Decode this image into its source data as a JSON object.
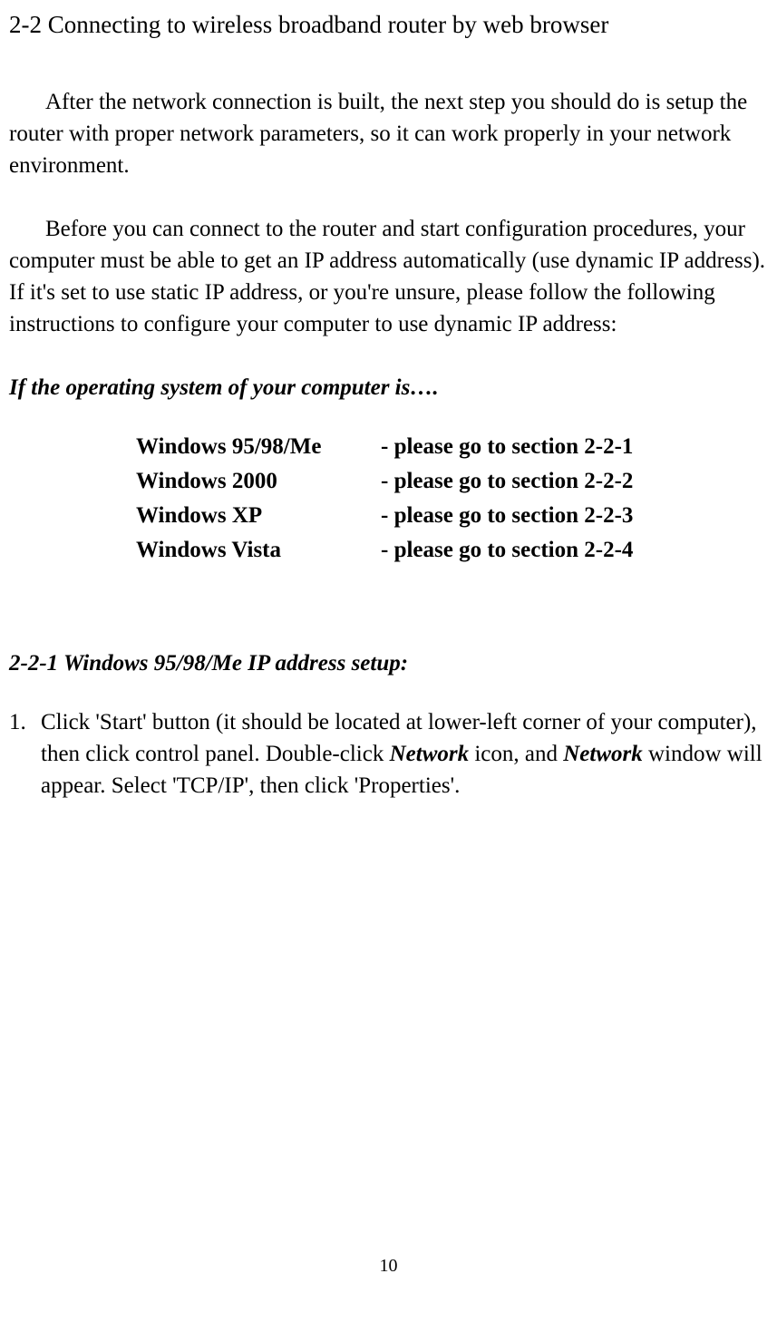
{
  "heading": "2-2 Connecting to wireless broadband router by web browser",
  "para1": "After the network connection is built, the next step you should do is setup the router with proper network parameters, so it can work properly in your network environment.",
  "para2": "Before you can connect to the router and start configuration procedures, your computer must be able to get an IP address automatically (use dynamic IP address). If it's set to use static IP address, or you're unsure, please follow the following instructions to configure your computer to use dynamic IP address:",
  "ifline": "If the operating system of your computer is….",
  "os": [
    {
      "name": "Windows 95/98/Me",
      "section": "- please go to section 2-2-1"
    },
    {
      "name": "Windows 2000",
      "section": "- please go to section 2-2-2"
    },
    {
      "name": "Windows XP",
      "section": "- please go to section 2-2-3"
    },
    {
      "name": "Windows Vista",
      "section": "- please go to section 2-2-4"
    }
  ],
  "subheading": "2-2-1 Windows 95/98/Me IP address setup:",
  "step1": {
    "num": "1.",
    "part1": "Click 'Start' button (it should be located at lower-left corner of your computer), then click control panel. Double-click ",
    "em1": "Network",
    "part2": " icon, and ",
    "em2": "Network",
    "part3": " window will appear. Select 'TCP/IP', then click 'Properties'."
  },
  "pagenum": "10"
}
